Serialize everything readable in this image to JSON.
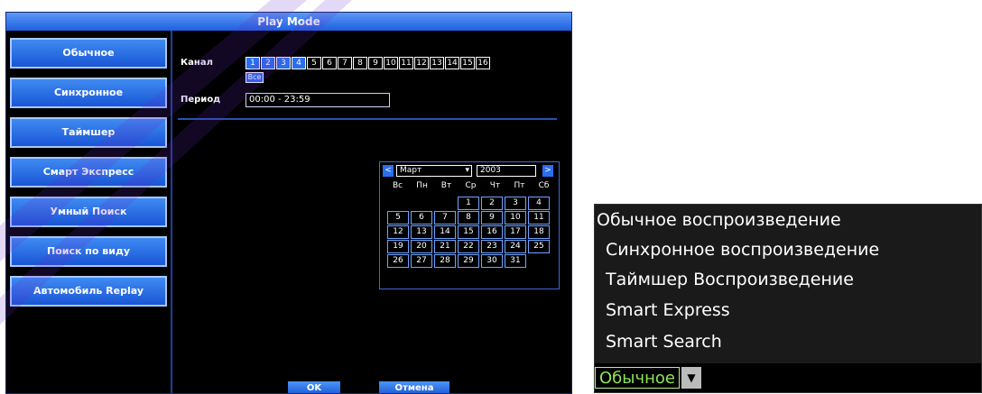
{
  "window": {
    "title": "Play Mode"
  },
  "sidebar": {
    "items": [
      {
        "label": "Обычное"
      },
      {
        "label": "Синхронное"
      },
      {
        "label": "Таймшер"
      },
      {
        "label": "Смарт Экспресс"
      },
      {
        "label": "Умный Поиск"
      },
      {
        "label": "Поиск по виду"
      },
      {
        "label": "Автомобиль Replay"
      }
    ]
  },
  "form": {
    "channel_label": "Канал",
    "channels": [
      "1",
      "2",
      "3",
      "4",
      "5",
      "6",
      "7",
      "8",
      "9",
      "10",
      "11",
      "12",
      "13",
      "14",
      "15",
      "16"
    ],
    "all_label": "Все",
    "period_label": "Период",
    "period_value": "00:00  -  23:59"
  },
  "calendar": {
    "month": "Март",
    "year": "2003",
    "prev_symbol": "<",
    "next_symbol": ">",
    "weekdays": [
      "Вс",
      "Пн",
      "Вт",
      "Ср",
      "Чт",
      "Пт",
      "Сб"
    ],
    "days": [
      "",
      "",
      "",
      "1",
      "2",
      "3",
      "4",
      "5",
      "6",
      "7",
      "8",
      "9",
      "10",
      "11",
      "12",
      "13",
      "14",
      "15",
      "16",
      "17",
      "18",
      "19",
      "20",
      "21",
      "22",
      "23",
      "24",
      "25",
      "26",
      "27",
      "28",
      "29",
      "30",
      "31"
    ]
  },
  "buttons": {
    "ok": "OK",
    "cancel": "Отмена"
  },
  "dropdown": {
    "options": [
      "Обычное воспроизведение",
      "Синхронное воспроизведение",
      "Таймшер Воспроизведение",
      "Smart Express",
      "Smart Search"
    ],
    "selected": "Обычное"
  },
  "colors": {
    "accent": "#2a6ef0",
    "title_bar": "#3c86f0",
    "selected_text": "#8fe35a"
  }
}
